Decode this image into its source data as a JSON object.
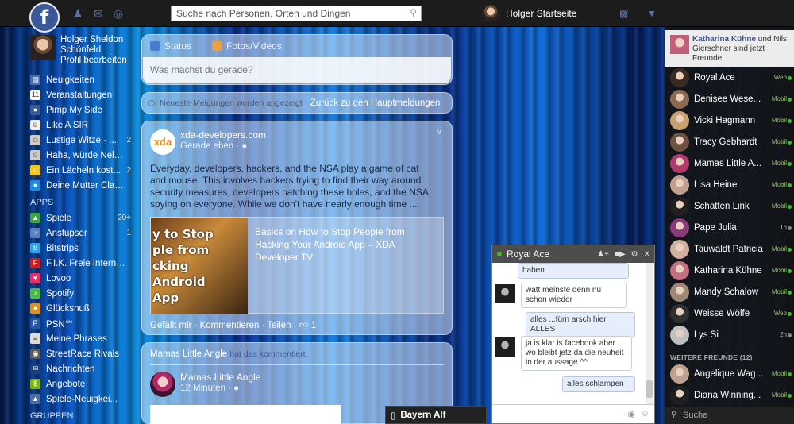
{
  "topbar": {
    "search_placeholder": "Suche nach Personen, Orten und Dingen",
    "profile_label": "Holger Startseite"
  },
  "left": {
    "user_name_line1": "Holger Sheldon",
    "user_name_line2": "Schönfeld",
    "edit_profile": "Profil bearbeiten",
    "items": [
      {
        "label": "Neuigkeiten",
        "count": "",
        "color": "#4a6ea9",
        "glyph": "▤"
      },
      {
        "label": "Veranstaltungen",
        "count": "",
        "color": "#ffffff",
        "glyph": "11"
      },
      {
        "label": "Pimp My Side",
        "count": "",
        "color": "#3b5998",
        "glyph": "●"
      },
      {
        "label": "Like A SIR",
        "count": "",
        "color": "#eeeeee",
        "glyph": "☺"
      },
      {
        "label": "Lustige Witze - ...",
        "count": "2",
        "color": "#cccccc",
        "glyph": "☺"
      },
      {
        "label": "Haha, würde Nels...",
        "count": "",
        "color": "#cccccc",
        "glyph": "☺"
      },
      {
        "label": "Ein Lächeln kost...",
        "count": "2",
        "color": "#f5c518",
        "glyph": "☺"
      },
      {
        "label": "Deine Mutter Clas...",
        "count": "",
        "color": "#1e88e5",
        "glyph": "●"
      }
    ],
    "apps_head": "APPS",
    "apps": [
      {
        "label": "Spiele",
        "count": "20+",
        "color": "#3aa34a",
        "glyph": "▲"
      },
      {
        "label": "Anstupser",
        "count": "1",
        "color": "#5c7fbf",
        "glyph": "☞"
      },
      {
        "label": "Bitstrips",
        "count": "",
        "color": "#2ea3f2",
        "glyph": "b"
      },
      {
        "label": "F.I.K. Freie Interne...",
        "count": "",
        "color": "#c71f1f",
        "glyph": "F"
      },
      {
        "label": "Lovoo",
        "count": "",
        "color": "#e62e6b",
        "glyph": "♥"
      },
      {
        "label": "Spotify",
        "count": "",
        "color": "#4cb848",
        "glyph": "♪"
      },
      {
        "label": "Glücksnuß!",
        "count": "",
        "color": "#d8902a",
        "glyph": "●"
      },
      {
        "label": "PSN℠",
        "count": "",
        "color": "#2356a4",
        "glyph": "P"
      },
      {
        "label": "Meine Phrases",
        "count": "",
        "color": "#dddddd",
        "glyph": "≡"
      },
      {
        "label": "StreetRace Rivals",
        "count": "",
        "color": "#5a5a5a",
        "glyph": "◉"
      },
      {
        "label": "Nachrichten",
        "count": "",
        "color": "#1c3f7a",
        "glyph": "✉"
      },
      {
        "label": "Angebote",
        "count": "",
        "color": "#7ab800",
        "glyph": "$"
      },
      {
        "label": "Spiele-Neuigkei...",
        "count": "",
        "color": "#4a6ea9",
        "glyph": "▲"
      }
    ],
    "groups_head": "GRUPPEN"
  },
  "composer": {
    "tab_status": "Status",
    "tab_photos": "Fotos/Videos",
    "placeholder": "Was machst du gerade?"
  },
  "notice": {
    "text": "Neueste Meldungen werden angezeigt",
    "link": "Zurück zu den Hauptmeldungen"
  },
  "post1": {
    "logo": "xda",
    "author": "xda-developers.com",
    "time": "Gerade eben · ",
    "text": "Everyday, developers, hackers, and the NSA play a game of cat and mouse. This involves hackers trying to find their way around security measures, developers patching these holes, and the NSA spying on everyone. While we don't have nearly enough time ...",
    "link_title": "Basics on How to Stop People from Hacking Your Android App – XDA Developer TV",
    "thumb_lines": [
      "y to Stop",
      "ple from",
      "cking",
      "Android",
      "App"
    ],
    "actions": "Gefällt mir · Kommentieren · Teilen · ",
    "likes": "1"
  },
  "post2": {
    "head": "Mamas Little Angle",
    "head_sub": "hat das kommentiert.",
    "author": "Mamas Little Angle",
    "time": "12 Minuten · "
  },
  "chat": {
    "name": "Royal Ace",
    "messages": [
      {
        "text": "haben",
        "mine": true
      },
      {
        "text": "watt meinste denn nu schon wieder",
        "mine": false
      },
      {
        "text": "alles ...fürn arsch hier ALLES",
        "mine": true
      },
      {
        "text": "ja is klar is facebook aber wo bleibt jetz da die neuheit in der aussage ^^",
        "mine": false
      },
      {
        "text": "alles schlampen",
        "mine": true
      }
    ]
  },
  "chat_tab": {
    "label": "Bayern Alf"
  },
  "right": {
    "ticker_name": "Katharina Kühne",
    "ticker_text": " und Nils Gierschner sind jetzt Freunde.",
    "friends": [
      {
        "name": "Royal Ace",
        "status": "Web",
        "idle": false
      },
      {
        "name": "Denisee Wese...",
        "status": "Mobil",
        "idle": false
      },
      {
        "name": "Vicki Hagmann",
        "status": "Mobil",
        "idle": false
      },
      {
        "name": "Tracy Gebhardt",
        "status": "Mobil",
        "idle": false
      },
      {
        "name": "Mamas Little A...",
        "status": "Mobil",
        "idle": false
      },
      {
        "name": "Lisa Heine",
        "status": "Mobil",
        "idle": false
      },
      {
        "name": "Schatten Link",
        "status": "Mobil",
        "idle": false
      },
      {
        "name": "Pape Julia",
        "status": "1h",
        "idle": true
      },
      {
        "name": "Tauwaldt Patricia",
        "status": "Mobil",
        "idle": false
      },
      {
        "name": "Katharina Kühne",
        "status": "Mobil",
        "idle": false
      },
      {
        "name": "Mandy Schalow",
        "status": "Mobil",
        "idle": false
      },
      {
        "name": "Weisse Wölfe",
        "status": "Web",
        "idle": false
      },
      {
        "name": "Lys Si",
        "status": "2h",
        "idle": true
      }
    ],
    "more_head": "WEITERE FREUNDE (12)",
    "more_friends": [
      {
        "name": "Angelique Wag...",
        "status": "Mobil",
        "idle": false
      },
      {
        "name": "Diana Winning...",
        "status": "Mobil",
        "idle": false
      }
    ],
    "search": "Suche"
  }
}
